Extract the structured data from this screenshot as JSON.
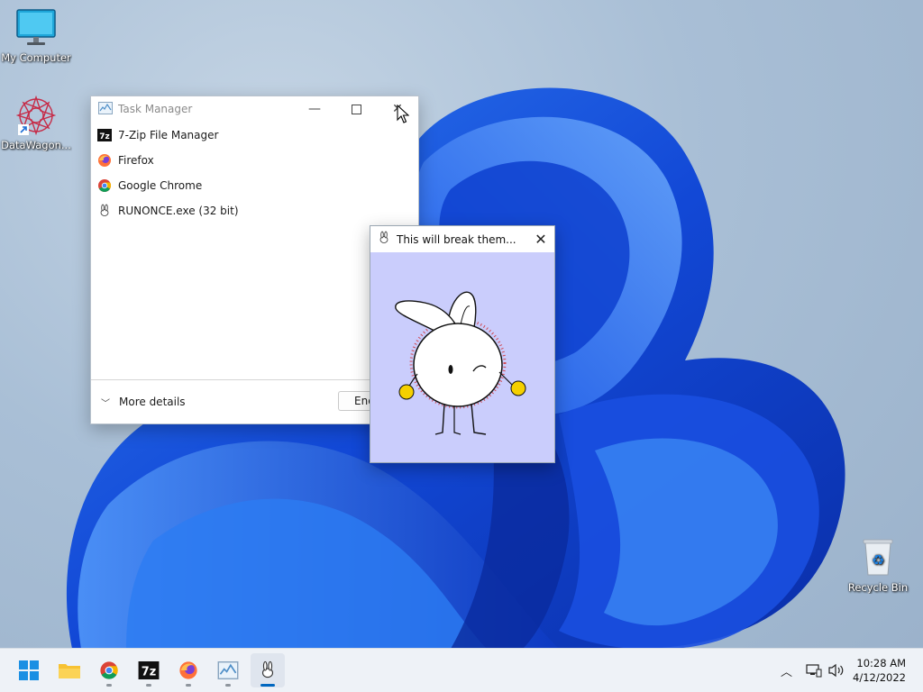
{
  "desktop": {
    "icons": [
      {
        "label": "My Computer",
        "icon": "computer-icon"
      },
      {
        "label": "DataWagon...",
        "icon": "datawagon-icon"
      },
      {
        "label": "Recycle Bin",
        "icon": "recycle-bin-icon"
      }
    ]
  },
  "task_manager": {
    "title": "Task Manager",
    "apps": [
      {
        "label": "7-Zip File Manager",
        "icon": "7zip-icon"
      },
      {
        "label": "Firefox",
        "icon": "firefox-icon"
      },
      {
        "label": "Google Chrome",
        "icon": "chrome-icon"
      },
      {
        "label": "RUNONCE.exe (32 bit)",
        "icon": "bunny-icon"
      }
    ],
    "more_details": "More details",
    "end_task": "End"
  },
  "dialog": {
    "title": "This will break them...",
    "image": "bunny-illustration"
  },
  "taskbar": {
    "items": [
      "start-icon",
      "file-explorer-icon",
      "chrome-icon",
      "7zip-icon",
      "firefox-icon",
      "task-manager-icon",
      "bunny-icon"
    ]
  },
  "clock": {
    "time": "10:28 AM",
    "date": "4/12/2022"
  },
  "colors": {
    "accent": "#0067c0",
    "wallpaper_blue": "#1f5fe0",
    "dialog_bg": "#cacdfc"
  }
}
